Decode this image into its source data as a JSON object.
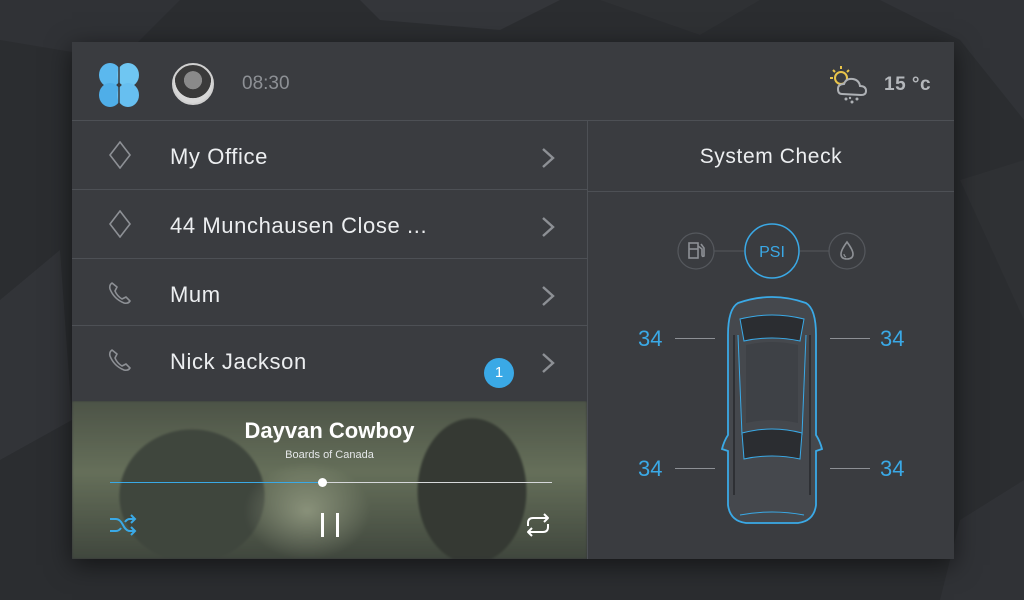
{
  "header": {
    "time": "08:30",
    "temperature": "15 °c"
  },
  "destinations": [
    {
      "label": "My Office",
      "icon": "diamond-pin-icon"
    },
    {
      "label": "44 Munchausen Close ...",
      "icon": "diamond-pin-icon"
    },
    {
      "label": "Mum",
      "icon": "phone-icon"
    },
    {
      "label": "Nick Jackson",
      "icon": "phone-icon",
      "badge": "1"
    }
  ],
  "player": {
    "title": "Dayvan Cowboy",
    "artist": "Boards of Canada",
    "progress": 0.48
  },
  "system_check": {
    "title": "System Check",
    "modes": [
      "fuel",
      "PSI",
      "fluid"
    ],
    "active_mode": "PSI",
    "tyres": {
      "front_left": "34",
      "front_right": "34",
      "rear_left": "34",
      "rear_right": "34"
    }
  },
  "colors": {
    "accent": "#3aa9e6",
    "panel": "#3a3c40",
    "background": "#2b2d30"
  }
}
